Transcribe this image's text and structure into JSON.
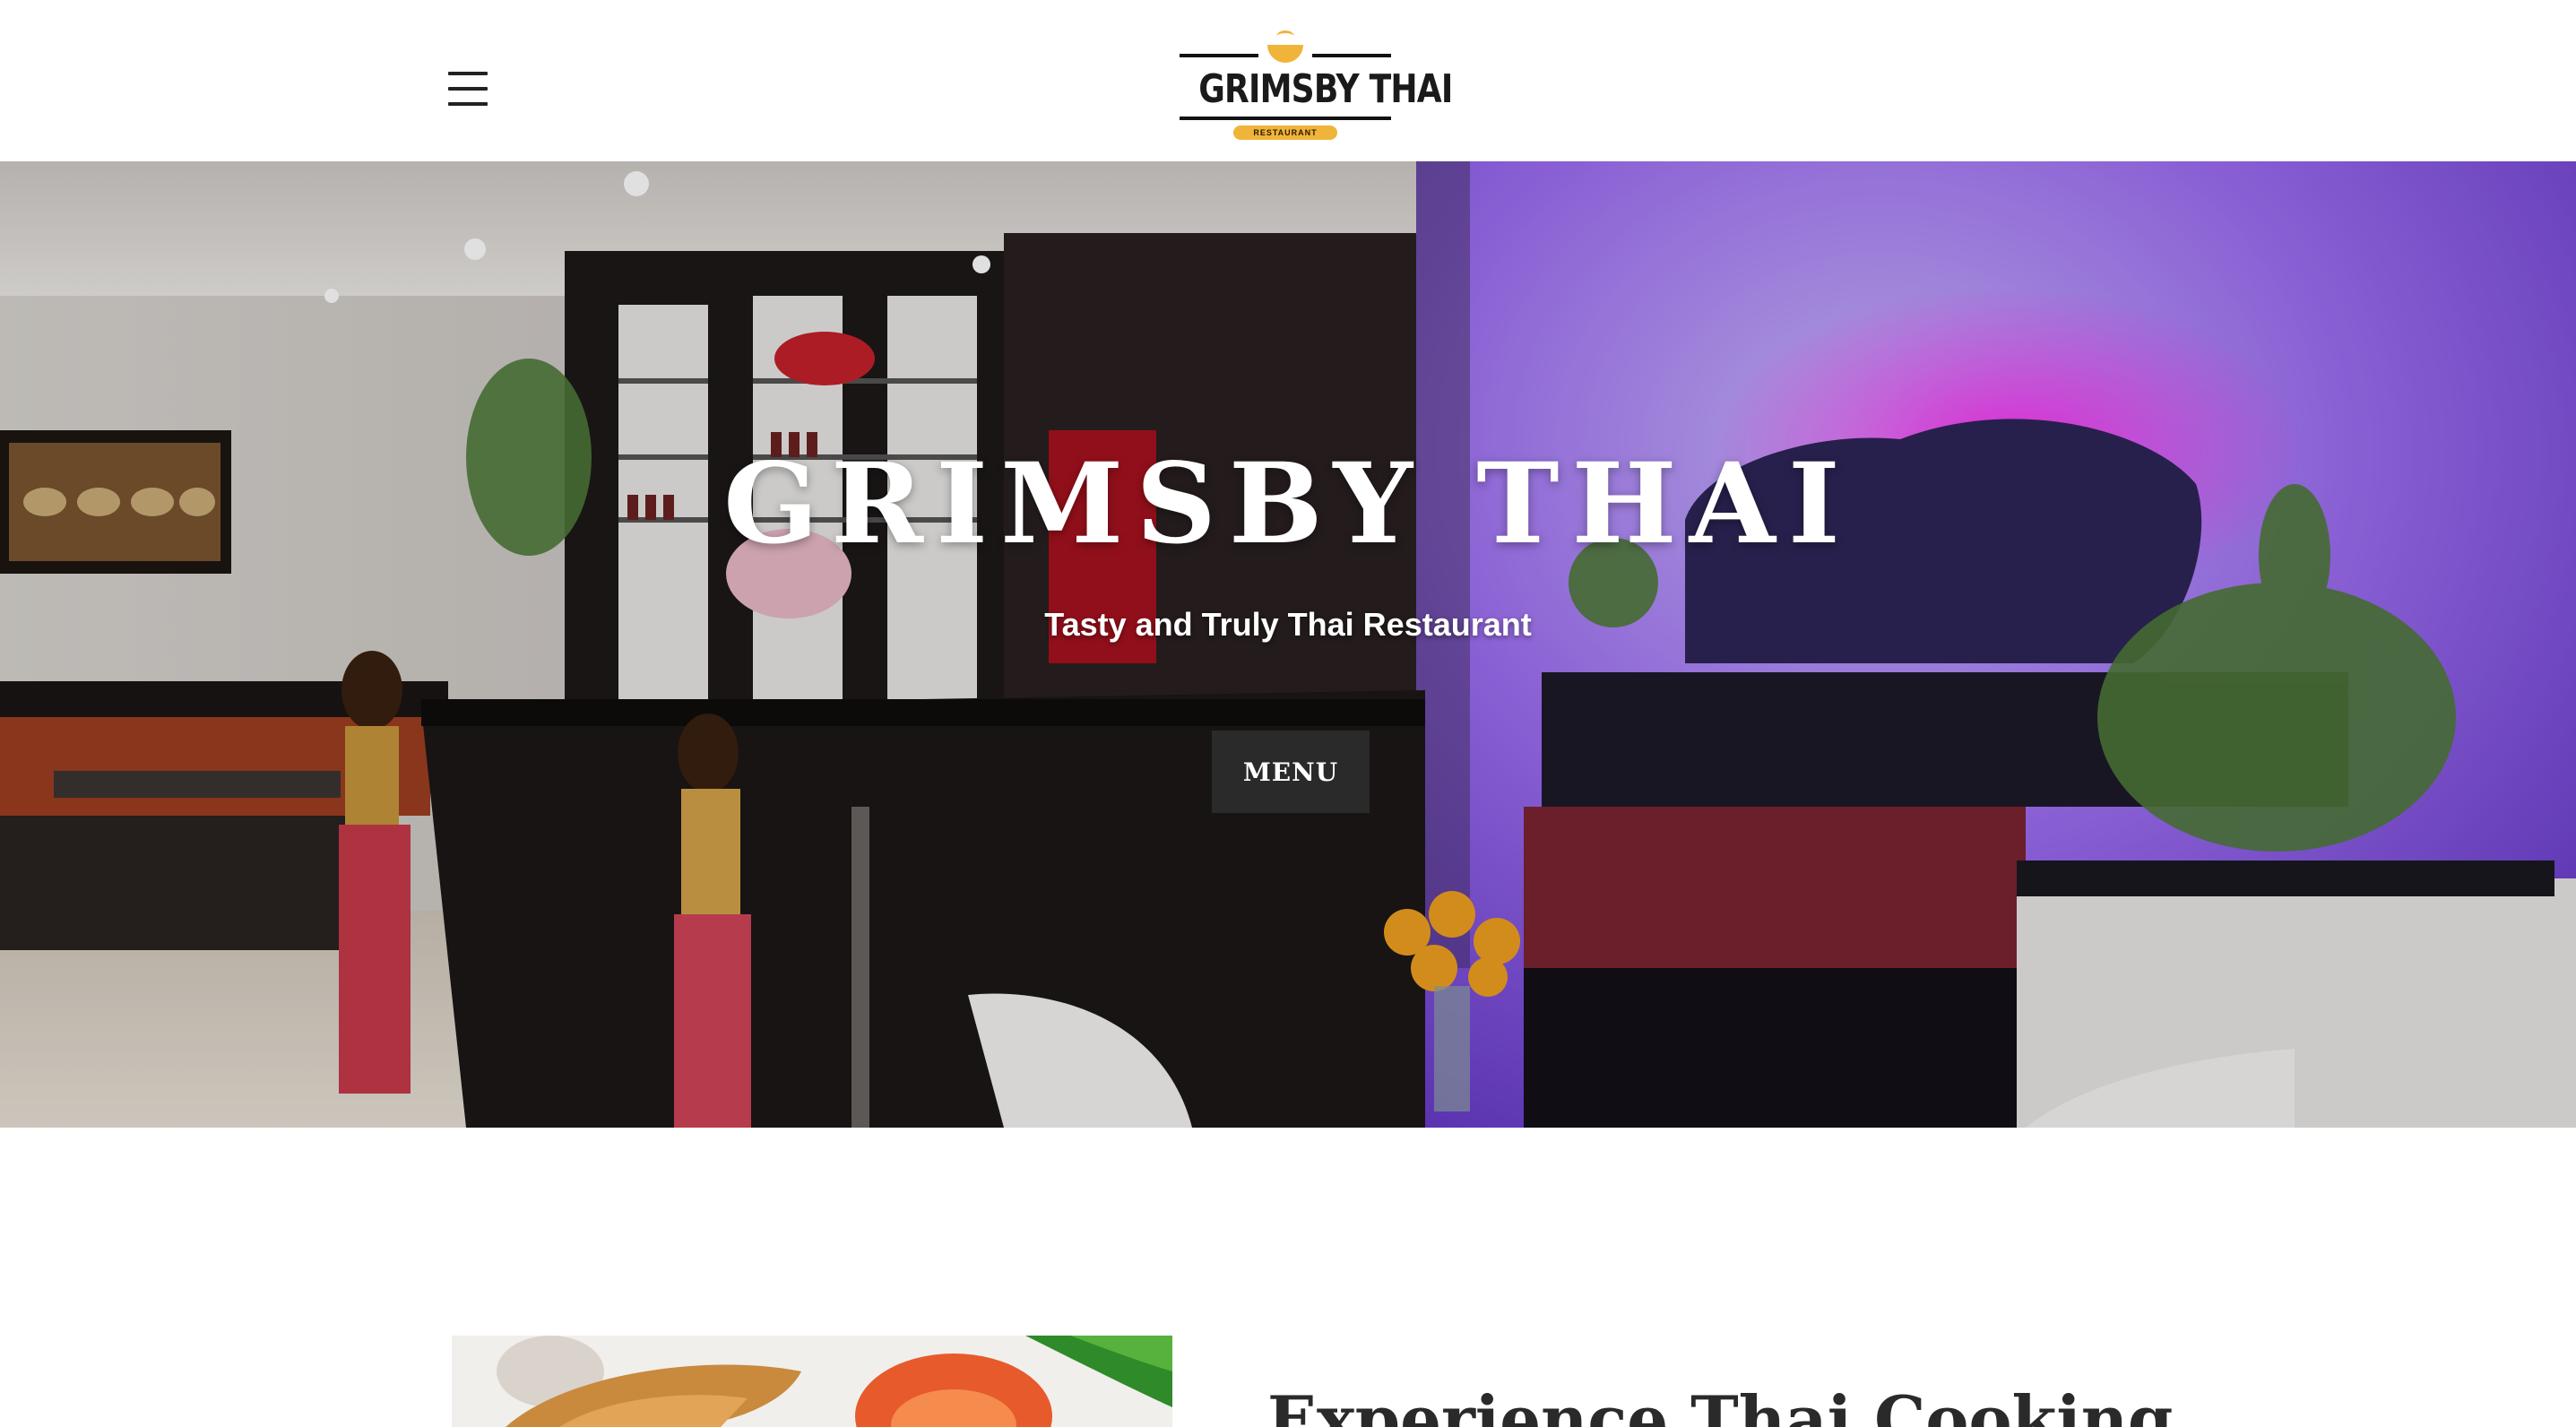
{
  "header": {
    "menu_icon": "hamburger-icon",
    "logo": {
      "name": "GRIMSBY THAI",
      "tagline": "RESTAURANT",
      "accent_color": "#f0b43a"
    }
  },
  "hero": {
    "title": "GRIMSBY THAI",
    "subtitle": "Tasty and Truly Thai Restaurant",
    "button_label": "MENU"
  },
  "intro": {
    "heading": "Experience Thai Cooking"
  }
}
